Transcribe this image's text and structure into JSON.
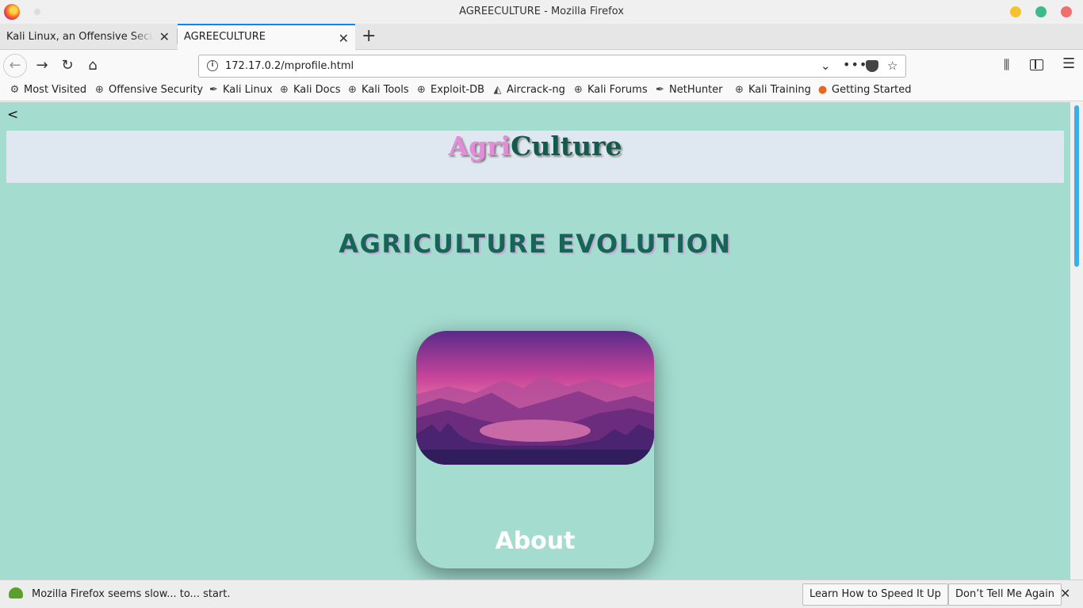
{
  "window": {
    "title": "AGREECULTURE - Mozilla Firefox"
  },
  "tabs": [
    {
      "label": "Kali Linux, an Offensive Security",
      "active": false
    },
    {
      "label": "AGREECULTURE",
      "active": true
    }
  ],
  "nav": {
    "url": "172.17.0.2/mprofile.html"
  },
  "bookmarks": [
    {
      "label": "Most Visited",
      "icon": "gear-icon"
    },
    {
      "label": "Offensive Security",
      "icon": "globe-icon"
    },
    {
      "label": "Kali Linux",
      "icon": "kali-dragon-icon"
    },
    {
      "label": "Kali Docs",
      "icon": "globe-icon"
    },
    {
      "label": "Kali Tools",
      "icon": "globe-icon"
    },
    {
      "label": "Exploit-DB",
      "icon": "globe-icon"
    },
    {
      "label": "Aircrack-ng",
      "icon": "aircrack-icon"
    },
    {
      "label": "Kali Forums",
      "icon": "globe-icon"
    },
    {
      "label": "NetHunter",
      "icon": "kali-dragon-icon"
    },
    {
      "label": "Kali Training",
      "icon": "globe-icon"
    },
    {
      "label": "Getting Started",
      "icon": "firefox-icon"
    }
  ],
  "page": {
    "back_link": "<",
    "brand_part1": "Agri",
    "brand_part2": "Culture",
    "headline": "AGRICULTURE EVOLUTION",
    "card_label": "About"
  },
  "notification": {
    "message": "Mozilla Firefox seems slow... to... start.",
    "learn_button": "Learn How to Speed It Up",
    "dismiss_button": "Don’t Tell Me Again"
  },
  "colors": {
    "page_background": "#a4ddd0",
    "brand_agri": "#e58bd9",
    "brand_culture": "#14594e",
    "headline": "#176556",
    "scrollbar_thumb": "#3daee9"
  }
}
